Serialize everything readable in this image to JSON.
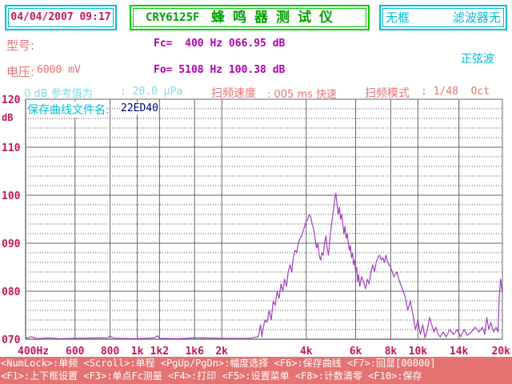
{
  "header": {
    "datetime": "04/04/2007 09:17",
    "model": "CRY6125F",
    "instrument_name": "蜂鸣器测试仪",
    "filter_frame": "无框",
    "filter_value": "滤波器无"
  },
  "params": {
    "model_label": "型号:",
    "voltage_label": "电压:",
    "voltage_value": "6000 mV",
    "fc": "Fc=  400 Hz 066.95 dB",
    "fo": "Fo= 5108 Hz 100.38 dB",
    "waveform": "正弦波",
    "reference_label": "0 dB 参考值为",
    "reference_value": ": 20.0 μPa",
    "sweep_speed_label": "扫频速度",
    "sweep_speed_value": ": 005 ms 快速",
    "sweep_mode_label": "扫频模式",
    "sweep_mode_value": ": 1/48  Oct",
    "save_curve_label": "保存曲线文件名:",
    "save_curve_value": "22ED40"
  },
  "colors": {
    "pink": "#c2185b",
    "magenta": "#b000b0",
    "cyan": "#00bcd4",
    "salmon": "#e57373",
    "green": "#00c800",
    "navy": "#000080",
    "curve": "#a040c0"
  },
  "chart_data": {
    "type": "line",
    "title": "",
    "xlabel": "",
    "ylabel": "dB",
    "xscale": "log",
    "ylim": [
      70,
      120
    ],
    "xlim": [
      400,
      20000
    ],
    "y_ticks": [
      "120",
      "110",
      "100",
      "090",
      "080",
      "070"
    ],
    "x_ticks": [
      "400Hz",
      "600",
      "800",
      "1k",
      "1k2",
      "1k6",
      "2k",
      "4k",
      "6k",
      "8k",
      "10k",
      "14k",
      "20k"
    ],
    "x_tick_values": [
      400,
      600,
      800,
      1000,
      1200,
      1600,
      2000,
      4000,
      6000,
      8000,
      10000,
      14000,
      20000
    ],
    "grid": true,
    "series": [
      {
        "points": [
          [
            400,
            70.2
          ],
          [
            420,
            70.5
          ],
          [
            440,
            70.1
          ],
          [
            480,
            70.3
          ],
          [
            530,
            70.1
          ],
          [
            600,
            70.2
          ],
          [
            780,
            70.3
          ],
          [
            800,
            70.6
          ],
          [
            830,
            70.2
          ],
          [
            1000,
            70.1
          ],
          [
            1150,
            70.3
          ],
          [
            1180,
            70.7
          ],
          [
            1200,
            70.2
          ],
          [
            1400,
            70.1
          ],
          [
            1600,
            70.3
          ],
          [
            2000,
            70.2
          ],
          [
            2500,
            70.2
          ],
          [
            2700,
            70.5
          ],
          [
            2750,
            73.0
          ],
          [
            2780,
            70.5
          ],
          [
            2800,
            72.0
          ],
          [
            2850,
            74.0
          ],
          [
            2900,
            73.5
          ],
          [
            2950,
            76.0
          ],
          [
            3000,
            74.0
          ],
          [
            3050,
            78.0
          ],
          [
            3100,
            77.0
          ],
          [
            3150,
            80.0
          ],
          [
            3200,
            78.5
          ],
          [
            3250,
            81.5
          ],
          [
            3300,
            80.0
          ],
          [
            3350,
            82.5
          ],
          [
            3400,
            81.0
          ],
          [
            3450,
            84.0
          ],
          [
            3500,
            85.5
          ],
          [
            3550,
            84.0
          ],
          [
            3600,
            87.0
          ],
          [
            3650,
            88.5
          ],
          [
            3700,
            88.0
          ],
          [
            3750,
            90.0
          ],
          [
            3800,
            91.0
          ],
          [
            3850,
            91.5
          ],
          [
            3900,
            92.5
          ],
          [
            3950,
            93.5
          ],
          [
            4000,
            94.5
          ],
          [
            4050,
            95.0
          ],
          [
            4100,
            96.0
          ],
          [
            4150,
            95.5
          ],
          [
            4200,
            94.0
          ],
          [
            4250,
            93.0
          ],
          [
            4300,
            91.0
          ],
          [
            4350,
            89.0
          ],
          [
            4400,
            90.0
          ],
          [
            4450,
            87.5
          ],
          [
            4500,
            86.5
          ],
          [
            4550,
            88.0
          ],
          [
            4600,
            87.5
          ],
          [
            4650,
            90.0
          ],
          [
            4700,
            91.5
          ],
          [
            4750,
            89.0
          ],
          [
            4800,
            87.5
          ],
          [
            4850,
            90.5
          ],
          [
            4900,
            93.0
          ],
          [
            4950,
            95.0
          ],
          [
            5000,
            97.0
          ],
          [
            5050,
            99.0
          ],
          [
            5100,
            100.4
          ],
          [
            5150,
            98.0
          ],
          [
            5200,
            96.0
          ],
          [
            5250,
            97.5
          ],
          [
            5300,
            95.0
          ],
          [
            5350,
            96.0
          ],
          [
            5400,
            94.0
          ],
          [
            5450,
            92.0
          ],
          [
            5500,
            93.5
          ],
          [
            5550,
            91.0
          ],
          [
            5600,
            92.0
          ],
          [
            5650,
            90.0
          ],
          [
            5700,
            88.5
          ],
          [
            5750,
            89.5
          ],
          [
            5800,
            87.0
          ],
          [
            5850,
            88.0
          ],
          [
            5900,
            85.5
          ],
          [
            5950,
            86.5
          ],
          [
            6000,
            84.0
          ],
          [
            6050,
            85.0
          ],
          [
            6100,
            82.0
          ],
          [
            6150,
            83.5
          ],
          [
            6200,
            81.0
          ],
          [
            6300,
            83.0
          ],
          [
            6400,
            82.0
          ],
          [
            6500,
            80.5
          ],
          [
            6600,
            82.5
          ],
          [
            6700,
            81.5
          ],
          [
            6800,
            84.0
          ],
          [
            6900,
            85.5
          ],
          [
            7000,
            84.0
          ],
          [
            7100,
            86.0
          ],
          [
            7200,
            87.0
          ],
          [
            7300,
            87.5
          ],
          [
            7400,
            86.5
          ],
          [
            7500,
            87.0
          ],
          [
            7600,
            86.0
          ],
          [
            7700,
            87.5
          ],
          [
            7800,
            86.0
          ],
          [
            7900,
            85.5
          ],
          [
            8000,
            85.0
          ],
          [
            8200,
            83.0
          ],
          [
            8400,
            84.0
          ],
          [
            8600,
            82.0
          ],
          [
            8800,
            80.5
          ],
          [
            9000,
            79.0
          ],
          [
            9200,
            76.0
          ],
          [
            9400,
            78.0
          ],
          [
            9600,
            75.0
          ],
          [
            9800,
            72.0
          ],
          [
            10000,
            74.0
          ],
          [
            10200,
            71.0
          ],
          [
            10400,
            73.0
          ],
          [
            10600,
            70.3
          ],
          [
            10800,
            72.0
          ],
          [
            11000,
            74.5
          ],
          [
            11200,
            73.0
          ],
          [
            11400,
            71.5
          ],
          [
            11600,
            72.5
          ],
          [
            11800,
            71.0
          ],
          [
            12000,
            70.5
          ],
          [
            12300,
            71.5
          ],
          [
            12600,
            70.5
          ],
          [
            13000,
            72.0
          ],
          [
            13400,
            71.0
          ],
          [
            13800,
            72.0
          ],
          [
            14200,
            70.5
          ],
          [
            14600,
            72.0
          ],
          [
            15000,
            70.8
          ],
          [
            15500,
            71.5
          ],
          [
            16000,
            72.5
          ],
          [
            16500,
            71.5
          ],
          [
            17000,
            72.5
          ],
          [
            17300,
            71.0
          ],
          [
            17600,
            74.5
          ],
          [
            17900,
            72.0
          ],
          [
            18200,
            73.5
          ],
          [
            18600,
            71.5
          ],
          [
            19000,
            72.5
          ],
          [
            19300,
            71.5
          ],
          [
            19500,
            79.0
          ],
          [
            19700,
            82.5
          ],
          [
            19850,
            81.0
          ],
          [
            20000,
            79.5
          ]
        ]
      }
    ]
  },
  "footer": {
    "line1": "<NumLock>:单频 <Scroll>:单程 <PgUp/PgDn>:幅度选择 <F6>:保存曲线 <F7>:回显[00000]",
    "line2": "<F1>:上下框设置 <F3>:单点Fc测量 <F4>:打印 <F5>:设置菜单 <F8>:计数清零 <F10>:保存"
  }
}
